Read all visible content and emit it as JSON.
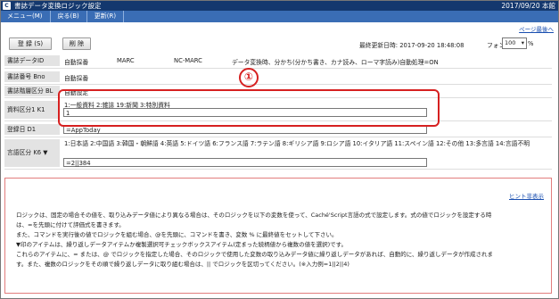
{
  "window": {
    "title": "書誌データ変換ロジック設定",
    "date_user": "2017/09/20 本館",
    "logo": "C"
  },
  "menu": [
    "メニュー(M)",
    "戻る(B)",
    "更新(R)"
  ],
  "top_link": "ページ最後へ",
  "toolbar": {
    "register": "登 録 (S)",
    "delete": "削 除"
  },
  "meta": {
    "last_update": "最終更新日時: 2017-09-20 18:48:08",
    "font_label": "フォント",
    "font_size": "100",
    "percent": "%"
  },
  "rows": {
    "id": {
      "label": "書誌データID",
      "values": [
        "自動採番",
        "MARC",
        "NC-MARC",
        "データ変換時、分かち(分かち書き、カナ読み、ローマ字読み)自動処理=ON"
      ]
    },
    "bno": {
      "label": "書誌番号 Bno",
      "value": "自動採番"
    },
    "bl": {
      "label": "書誌階層区分 BL",
      "value": "自動設定"
    },
    "k1": {
      "label": "資料区分1 K1",
      "hint": "1:一般資料 2:雑誌 19:新聞 3:特別資料",
      "input": "1"
    },
    "d1": {
      "label": "登録日 D1",
      "input": "=AppToday"
    },
    "k6": {
      "label": "言語区分 K6 ▼",
      "hint": "1:日本語 2:中国語 3:韓国・朝鮮語 4:英語 5:ドイツ語 6:フランス語 7:ラテン語 8:ギリシア語 9:ロシア語 10:イタリア語 11:スペイン語 12:その他 13:多言語 14:言語不明",
      "input": "=2||384"
    }
  },
  "annotation": {
    "marker": "①"
  },
  "info": {
    "hint_link": "ヒント非表示",
    "lines": [
      "ロジックは、固定の場合その値を、取り込みデータ値により異なる場合は、そのロジックを以下の変数を使って、Caché'Script言語の式で設定します。式の値でロジックを設定する時",
      "は、=を先頭に付けて評価式を書きます。",
      "また、コマンドを実行後の値でロジックを組む場合、@を先頭に、コマンドを書き、変数 % に最終値をセットして下さい。",
      "▼印のアイテムは、繰り返しデータアイテムか複製選択可チェックボックスアイテム(定まった続柄値から複数の値を選択)です。",
      "これらのアイテムに、= または、@ でロジックを指定した場合、そのロジックで使用した変数の取り込みデータ値に繰り返しデータがあれば、自動的に、繰り返しデータが作成されま",
      "す。また、複数のロジックをその順で繰り返しデータに取り組む場合は、|| でロジックを区切ってください。(※入力例=1||2||4)"
    ]
  }
}
